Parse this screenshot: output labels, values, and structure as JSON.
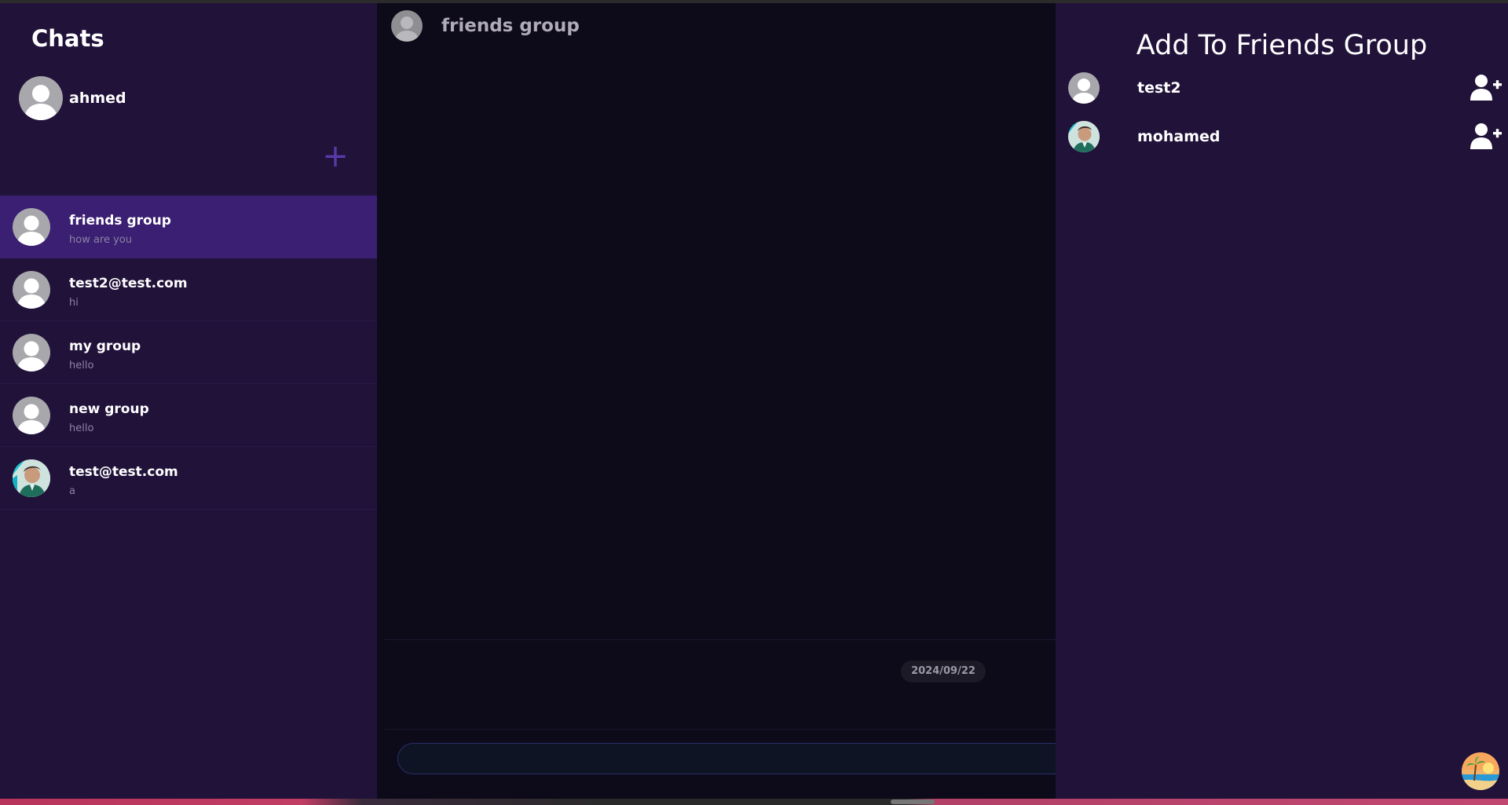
{
  "sidebar": {
    "title": "Chats",
    "current_user": "ahmed",
    "new_chat_symbol": "+",
    "chats": [
      {
        "name": "friends group",
        "preview": "how are you",
        "active": true,
        "avatar": "default"
      },
      {
        "name": "test2@test.com",
        "preview": "hi",
        "active": false,
        "avatar": "default"
      },
      {
        "name": "my group",
        "preview": "hello",
        "active": false,
        "avatar": "default"
      },
      {
        "name": "new group",
        "preview": "hello",
        "active": false,
        "avatar": "default"
      },
      {
        "name": "test@test.com",
        "preview": "a",
        "active": false,
        "avatar": "photo"
      }
    ]
  },
  "main": {
    "title": "friends group",
    "date_label": "2024/09/22",
    "input_placeholder": ""
  },
  "panel": {
    "title": "Add To Friends Group",
    "users": [
      {
        "name": "test2",
        "avatar": "default",
        "action_icon": "add-user-icon"
      },
      {
        "name": "mohamed",
        "avatar": "photo",
        "action_icon": "add-user-icon"
      }
    ]
  },
  "colors": {
    "sidebar_bg": "#21123a",
    "active_chat": "#3a1f72",
    "main_bg": "#0d0a19",
    "accent": "#5a3aa8"
  }
}
